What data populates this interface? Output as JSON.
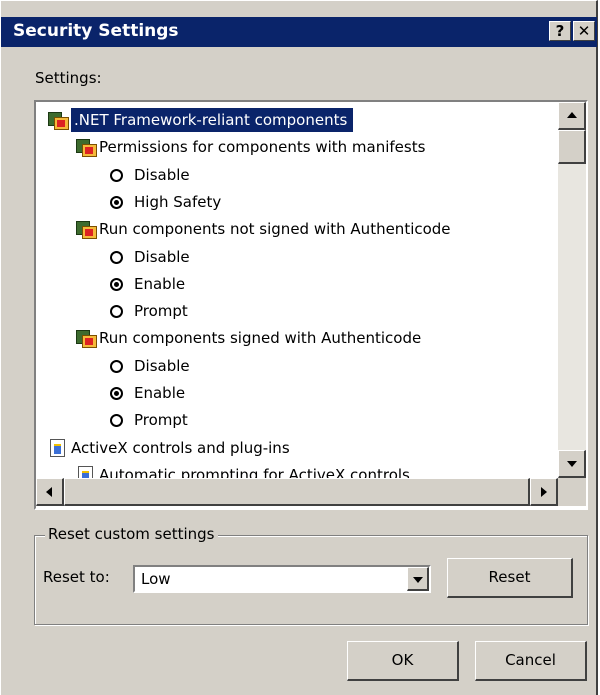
{
  "window": {
    "title": "Security Settings",
    "help_label": "?",
    "close_label": "✕"
  },
  "settings_label": "Settings:",
  "tree": {
    "rows": [
      {
        "type": "category",
        "icon": "net-framework-icon",
        "label": ".NET Framework-reliant components",
        "selected": true
      },
      {
        "type": "setting",
        "icon": "net-framework-icon",
        "label": "Permissions for components with manifests"
      },
      {
        "type": "option",
        "label": "Disable",
        "checked": false
      },
      {
        "type": "option",
        "label": "High Safety",
        "checked": true
      },
      {
        "type": "setting",
        "icon": "net-framework-icon",
        "label": "Run components not signed with Authenticode"
      },
      {
        "type": "option",
        "label": "Disable",
        "checked": false
      },
      {
        "type": "option",
        "label": "Enable",
        "checked": true
      },
      {
        "type": "option",
        "label": "Prompt",
        "checked": false
      },
      {
        "type": "setting",
        "icon": "net-framework-icon",
        "label": "Run components signed with Authenticode"
      },
      {
        "type": "option",
        "label": "Disable",
        "checked": false
      },
      {
        "type": "option",
        "label": "Enable",
        "checked": true
      },
      {
        "type": "option",
        "label": "Prompt",
        "checked": false
      },
      {
        "type": "category",
        "icon": "activex-icon",
        "label": "ActiveX controls and plug-ins"
      },
      {
        "type": "setting",
        "icon": "activex-icon",
        "label": "Automatic prompting for ActiveX controls"
      }
    ]
  },
  "reset_group": {
    "title": "Reset custom settings",
    "reset_to_label": "Reset to:",
    "reset_to_value": "Low",
    "reset_button": "Reset"
  },
  "buttons": {
    "ok": "OK",
    "cancel": "Cancel"
  }
}
